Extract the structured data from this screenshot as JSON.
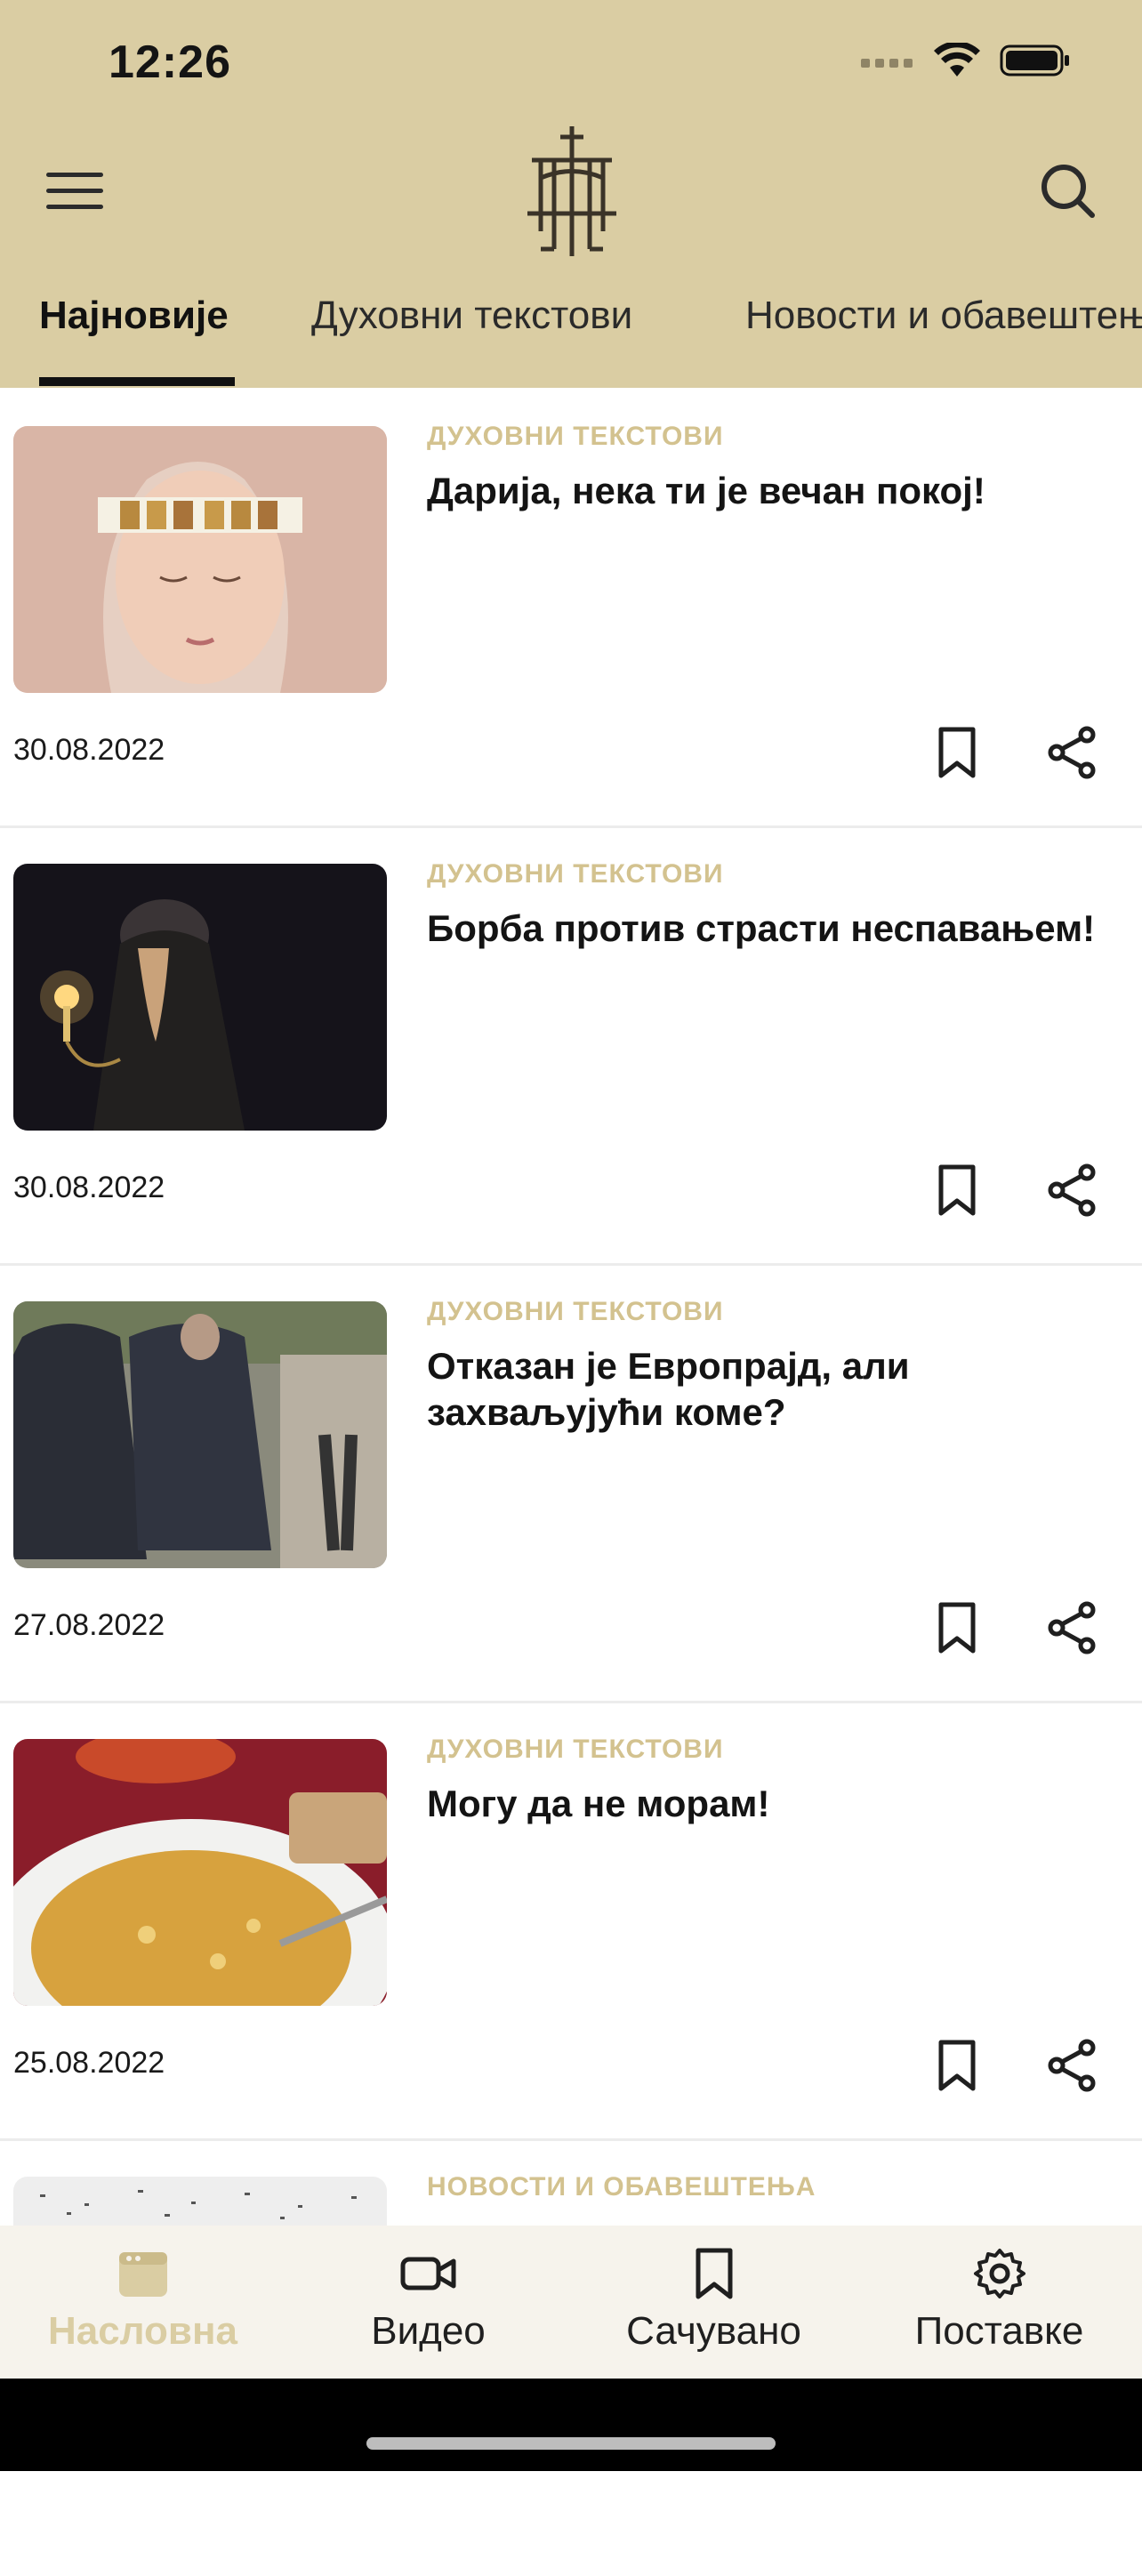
{
  "status_bar": {
    "time": "12:26"
  },
  "header": {
    "tabs": [
      {
        "label": "Најновије",
        "active": true
      },
      {
        "label": "Духовни текстови",
        "active": false
      },
      {
        "label": "Новости и обавештења",
        "active": false
      }
    ]
  },
  "feed": [
    {
      "category": "ДУХОВНИ ТЕКСТОВИ",
      "title": "Дарија, нека ти је вечан покој!",
      "date": "30.08.2022"
    },
    {
      "category": "ДУХОВНИ ТЕКСТОВИ",
      "title": "Борба против страсти неспавањем!",
      "date": "30.08.2022"
    },
    {
      "category": "ДУХОВНИ ТЕКСТОВИ",
      "title": "Отказан је Европрајд, али захваљујући коме?",
      "date": "27.08.2022"
    },
    {
      "category": "ДУХОВНИ ТЕКСТОВИ",
      "title": "Могу да не морам!",
      "date": "25.08.2022"
    },
    {
      "category": "НОВОСТИ И ОБАВЕШТЕЊА",
      "title": "",
      "date": ""
    }
  ],
  "bottom_nav": {
    "items": [
      {
        "label": "Насловна",
        "icon": "home-icon",
        "active": true
      },
      {
        "label": "Видео",
        "icon": "video-icon",
        "active": false
      },
      {
        "label": "Сачувано",
        "icon": "bookmark-icon",
        "active": false
      },
      {
        "label": "Поставке",
        "icon": "gear-icon",
        "active": false
      }
    ]
  },
  "colors": {
    "header_bg": "#dacda3",
    "accent": "#d3c28f",
    "text": "#141414"
  }
}
